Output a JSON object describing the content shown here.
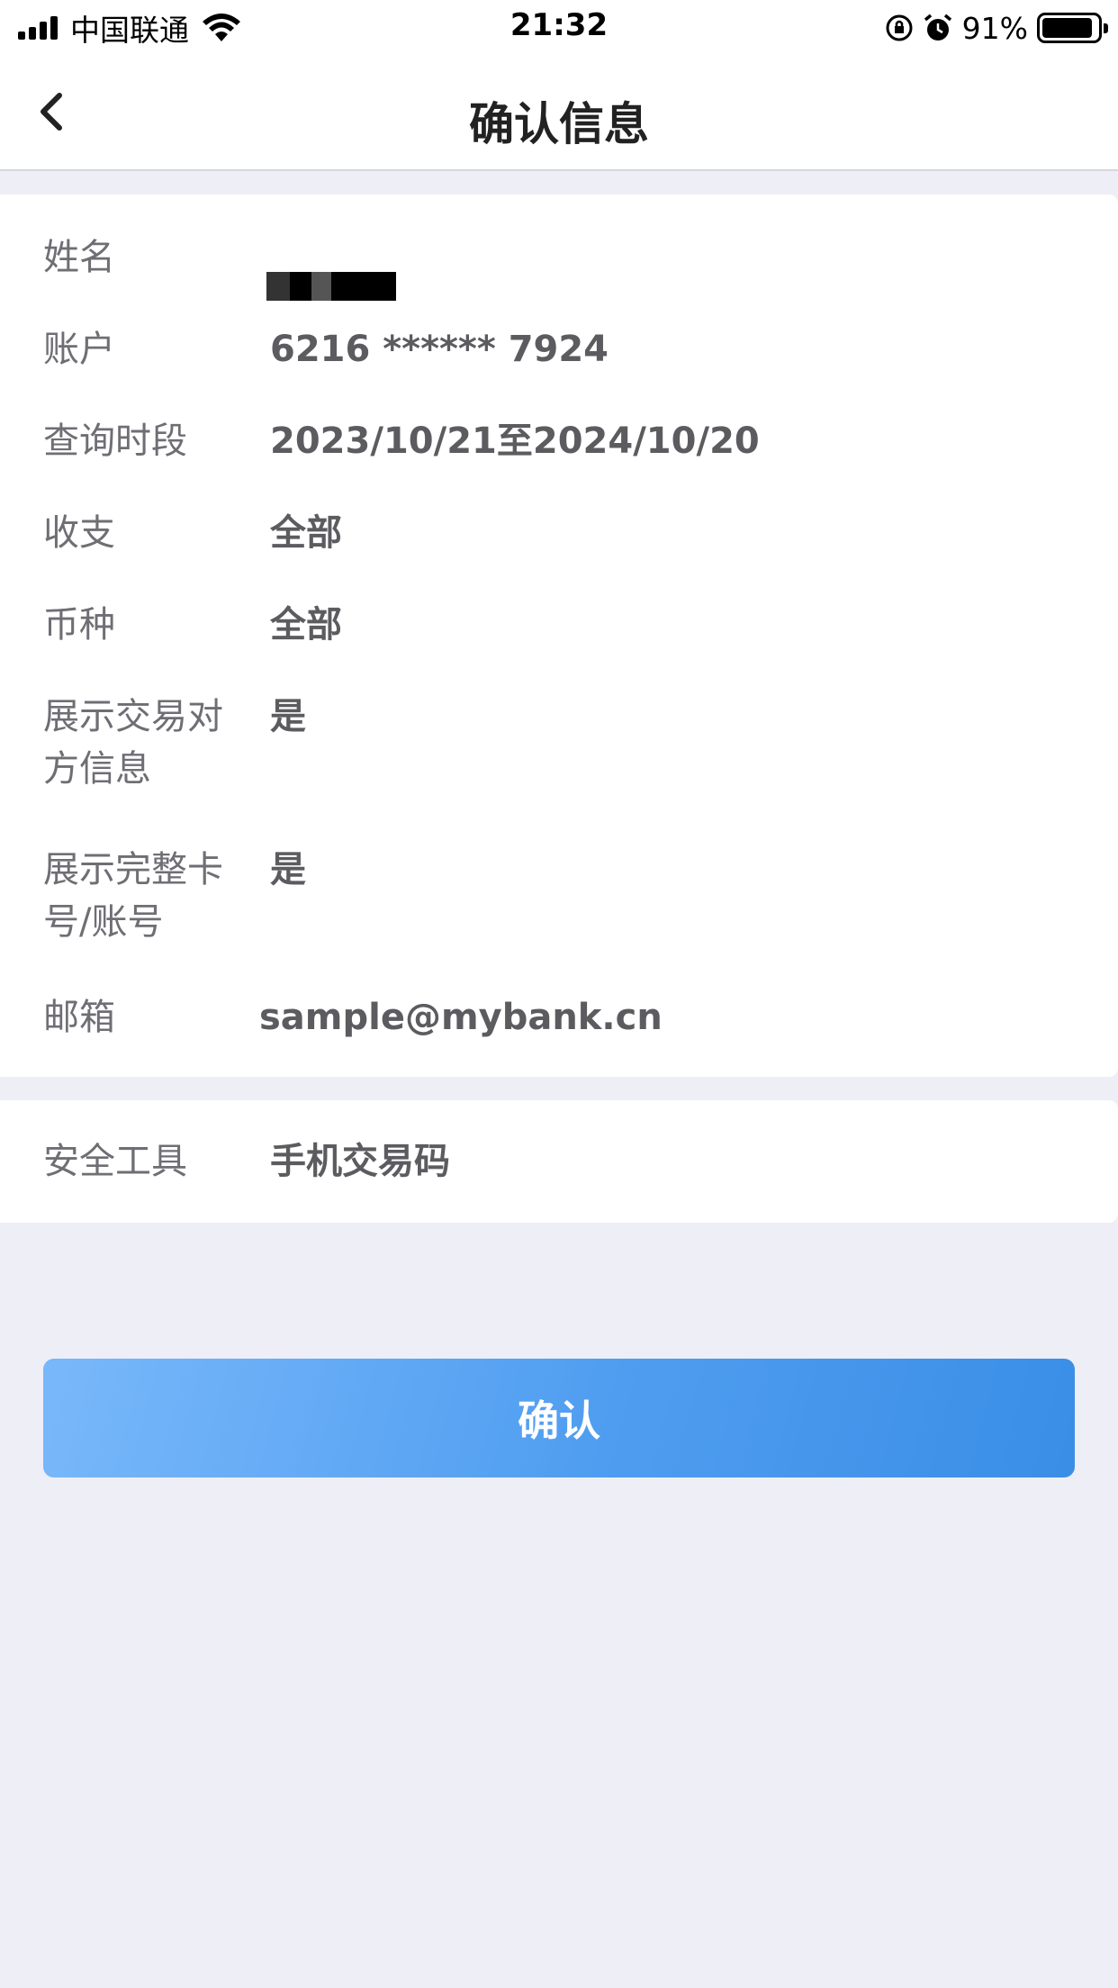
{
  "status_bar": {
    "carrier": "中国联通",
    "time": "21:32",
    "battery_percent": "91%",
    "battery_level": 0.91,
    "icons": [
      "signal-icon",
      "wifi-icon",
      "orientation-lock-icon",
      "alarm-icon",
      "battery-icon"
    ]
  },
  "nav": {
    "title": "确认信息",
    "back_icon": "chevron-left-icon"
  },
  "info": {
    "name_label": "姓名",
    "account_label": "账户",
    "account_value": "6216 ****** 7924",
    "period_label": "查询时段",
    "period_value": "2023/10/21至2024/10/20",
    "inout_label": "收支",
    "inout_value": "全部",
    "currency_label": "币种",
    "currency_value": "全部",
    "counterparty_label_1": "展示交易对",
    "counterparty_label_2": "方信息",
    "counterparty_value": "是",
    "fullcard_label_1": "展示完整卡",
    "fullcard_label_2": "号/账号",
    "fullcard_value": "是",
    "email_label": "邮箱",
    "email_value": "sample@mybank.cn"
  },
  "security": {
    "label": "安全工具",
    "value": "手机交易码"
  },
  "confirm_button": "确认",
  "colors": {
    "background": "#eeeef6",
    "button_start": "#79b8fa",
    "button_end": "#3a8ee6",
    "label": "#6e6e74",
    "value": "#5c5c60"
  }
}
